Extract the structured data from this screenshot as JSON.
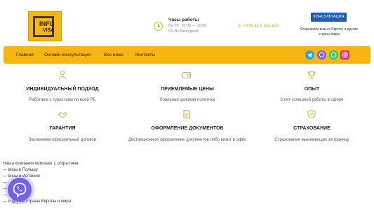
{
  "logo": {
    "line1": "INFO",
    "line2": "VISA"
  },
  "hours": {
    "title": "Часы работы",
    "line1": "Пн-Пт: 10:00 — 19:00",
    "line2": "Сб-Вс Выходной"
  },
  "phone": {
    "number": "+375 44 5 606 607"
  },
  "cta": {
    "label": "КОНСУЛЬТАЦИЯ",
    "note": "Открываем визы в Европу и другие страны мира"
  },
  "nav": {
    "items": [
      "Главная",
      "Онлайн-консультация",
      "Все визы",
      "Контакты"
    ]
  },
  "social": [
    "telegram-icon",
    "viber-icon",
    "whatsapp-icon",
    "instagram-icon"
  ],
  "features": [
    {
      "title": "ИНДИВИДУАЛЬНЫЙ ПОДХОД",
      "desc": "Работаем с туристами по всей РБ",
      "icon": "person-icon"
    },
    {
      "title": "ПРИЕМЛЕМЫЕ ЦЕНЫ",
      "desc": "Лояльная ценовая политика",
      "icon": "wallet-icon"
    },
    {
      "title": "ОПЫТ",
      "desc": "8 лет успешной работы в сфере",
      "icon": "trophy-icon"
    },
    {
      "title": "ГАРАНТИЯ",
      "desc": "Заключаем официальный договор",
      "icon": "handshake-icon"
    },
    {
      "title": "ОФОРМЛЕНИЕ ДОКУМЕНТОВ",
      "desc": "Дистанционное оформление документов либо визит в офис",
      "icon": "document-icon"
    },
    {
      "title": "СТРАХОВАНИЕ",
      "desc": "Страхование выезжающих за границу",
      "icon": "shield-icon"
    }
  ],
  "intro": {
    "heading": "Наша компания помогает с открытием:",
    "lines": [
      "— визы в Польшу",
      "— визы в Испанию",
      "— ...нию",
      "— ...енцию",
      "— ...лию",
      "— и другие страны Европы и мира"
    ]
  },
  "colors": {
    "accent": "#f6b60f",
    "button": "#1f5fb2",
    "icon": "#e0b13c"
  }
}
